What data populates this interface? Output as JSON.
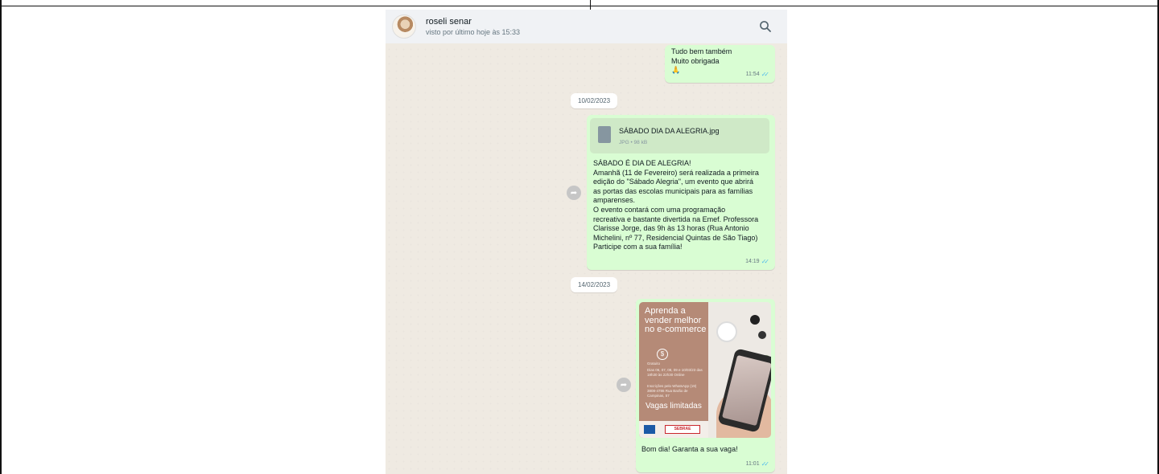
{
  "header": {
    "contact_name": "roseli senar",
    "last_seen": "visto por último hoje às 15:33"
  },
  "messages": {
    "m1": {
      "lines": [
        "Tudo bem também",
        "Muito obrigada",
        "🙏"
      ],
      "time": "11:54"
    },
    "date1": "10/02/2023",
    "m2": {
      "file_name": "SÁBADO DIA DA ALEGRIA.jpg",
      "file_meta": "JPG • 98 kB",
      "lines": [
        "SÁBADO É DIA DE ALEGRIA!",
        "Amanhã (11 de Fevereiro) será realizada a primeira",
        "edição do \"Sábado Alegria\", um evento que abrirá",
        "as portas das escolas municipais para as famílias",
        "amparenses.",
        "O evento contará com uma programação",
        "recreativa e bastante divertida na Emef. Professora",
        "Clarisse Jorge, das 9h às 13 horas (Rua Antonio",
        "Michelini, nº 77, Residencial Quintas de São Tiago)",
        "Participe com a sua família!"
      ],
      "time": "14:19"
    },
    "date2": "14/02/2023",
    "m3": {
      "poster": {
        "headline": "Aprenda a vender melhor no e-commerce",
        "line_a": "Gratuito",
        "line_b": "Dias 06, 07, 08, 09 e 10/03/23 das 18h30 às 22h30 Online",
        "line_c": "Inscrições pelo WhatsApp (19) 3808-4786 Rua Barão de Campinas, 57",
        "vagas": "Vagas limitadas",
        "logo": "SEBRAE"
      },
      "caption": "Bom dia! Garanta a sua vaga!",
      "time": "11:01"
    }
  },
  "icons": {
    "search": "search-icon",
    "forward": "forward-icon",
    "file": "file-icon",
    "tick": "double-check-icon"
  },
  "colors": {
    "bubble_out": "#d9fdd3",
    "chat_bg": "#efeae2",
    "header_bg": "#f0f2f5",
    "tick": "#53bdeb"
  }
}
